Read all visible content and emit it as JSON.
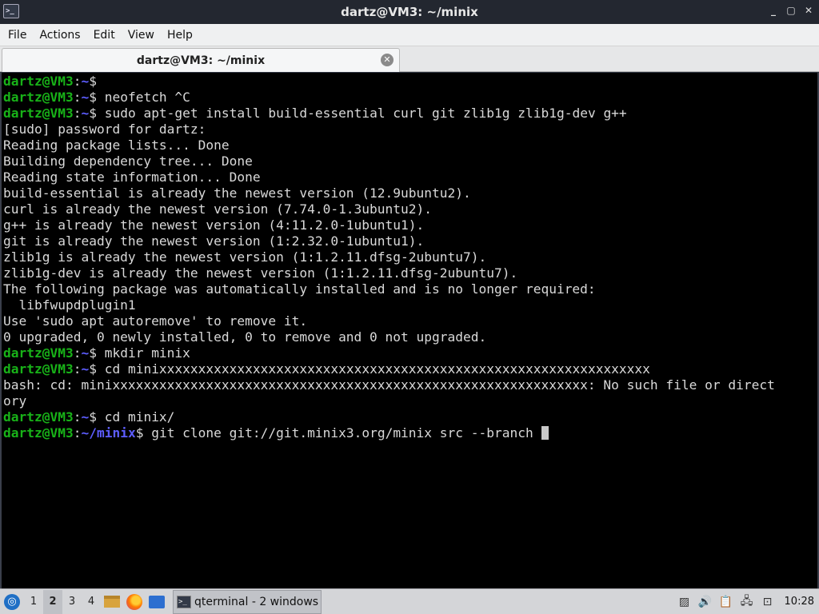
{
  "window": {
    "title": "dartz@VM3: ~/minix",
    "buttons": {
      "minimize": "_",
      "maximize": "▢",
      "close": "✕"
    }
  },
  "menu": [
    "File",
    "Actions",
    "Edit",
    "View",
    "Help"
  ],
  "tab": {
    "label": "dartz@VM3: ~/minix",
    "close_glyph": "✕"
  },
  "terminal": {
    "user_host": "dartz@VM3",
    "lines": [
      {
        "type": "prompt",
        "path": "~",
        "cmd": ""
      },
      {
        "type": "prompt",
        "path": "~",
        "cmd": " neofetch ^C"
      },
      {
        "type": "prompt",
        "path": "~",
        "cmd": " sudo apt-get install build-essential curl git zlib1g zlib1g-dev g++"
      },
      {
        "type": "out",
        "text": "[sudo] password for dartz:"
      },
      {
        "type": "out",
        "text": "Reading package lists... Done"
      },
      {
        "type": "out",
        "text": "Building dependency tree... Done"
      },
      {
        "type": "out",
        "text": "Reading state information... Done"
      },
      {
        "type": "out",
        "text": "build-essential is already the newest version (12.9ubuntu2)."
      },
      {
        "type": "out",
        "text": "curl is already the newest version (7.74.0-1.3ubuntu2)."
      },
      {
        "type": "out",
        "text": "g++ is already the newest version (4:11.2.0-1ubuntu1)."
      },
      {
        "type": "out",
        "text": "git is already the newest version (1:2.32.0-1ubuntu1)."
      },
      {
        "type": "out",
        "text": "zlib1g is already the newest version (1:1.2.11.dfsg-2ubuntu7)."
      },
      {
        "type": "out",
        "text": "zlib1g-dev is already the newest version (1:1.2.11.dfsg-2ubuntu7)."
      },
      {
        "type": "out",
        "text": "The following package was automatically installed and is no longer required:"
      },
      {
        "type": "out",
        "text": "  libfwupdplugin1"
      },
      {
        "type": "out",
        "text": "Use 'sudo apt autoremove' to remove it."
      },
      {
        "type": "out",
        "text": "0 upgraded, 0 newly installed, 0 to remove and 0 not upgraded."
      },
      {
        "type": "prompt",
        "path": "~",
        "cmd": " mkdir minix"
      },
      {
        "type": "prompt",
        "path": "~",
        "cmd": " cd minixxxxxxxxxxxxxxxxxxxxxxxxxxxxxxxxxxxxxxxxxxxxxxxxxxxxxxxxxxxxxxx"
      },
      {
        "type": "out",
        "text": "bash: cd: minixxxxxxxxxxxxxxxxxxxxxxxxxxxxxxxxxxxxxxxxxxxxxxxxxxxxxxxxxxxxx: No such file or direct"
      },
      {
        "type": "out",
        "text": "ory"
      },
      {
        "type": "prompt",
        "path": "~",
        "cmd": " cd minix/"
      },
      {
        "type": "prompt",
        "path": "~/minix",
        "cmd": " git clone git://git.minix3.org/minix src --branch ",
        "cursor": true
      }
    ]
  },
  "taskbar": {
    "desktops": [
      "1",
      "2",
      "3",
      "4"
    ],
    "active_desktop": "2",
    "task_label": "qterminal - 2 windows",
    "clock": "10:28"
  },
  "colors": {
    "prompt_user": "#18b218",
    "prompt_path": "#5d5dff",
    "terminal_bg": "#000000",
    "terminal_fg": "#d9d9d9"
  }
}
